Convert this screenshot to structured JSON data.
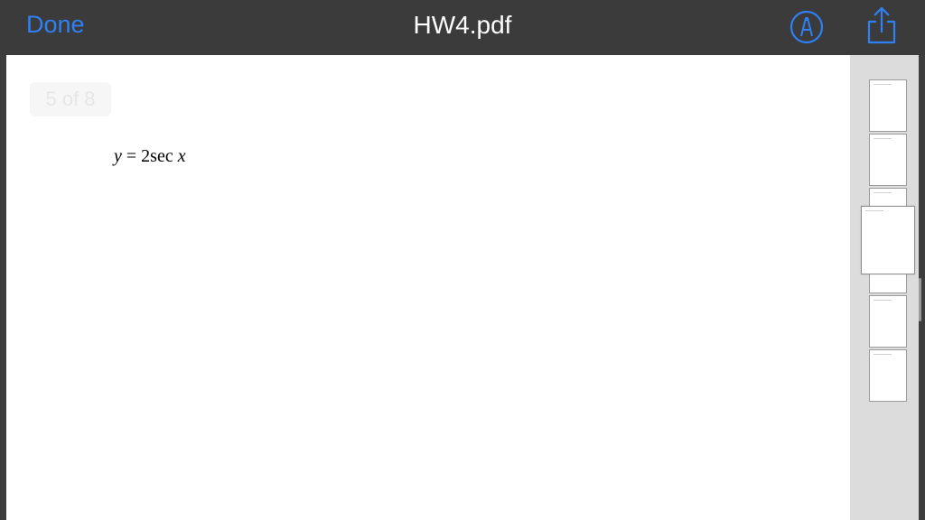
{
  "toolbar": {
    "done_label": "Done",
    "title": "HW4.pdf",
    "markup_icon": "markup-pen-icon",
    "share_icon": "share-icon",
    "accent_color": "#2f7ff5"
  },
  "document": {
    "page_indicator": "5 of 8",
    "equation": {
      "lhs": "y",
      "eq": " = ",
      "coef": "2sec",
      "arg": "x"
    }
  },
  "thumbnails": {
    "count": 8,
    "current_page": 5
  }
}
